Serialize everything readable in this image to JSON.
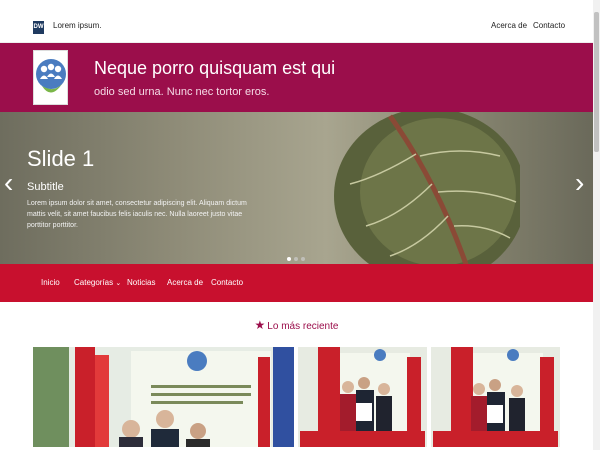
{
  "topbar": {
    "logo_text": "DW",
    "brand": "Lorem ipsum.",
    "links": [
      "Acerca de",
      "Contacto"
    ]
  },
  "header": {
    "title": "Neque porro quisquam est qui",
    "subtitle": "odio sed urna. Nunc nec tortor eros."
  },
  "hero": {
    "title": "Slide 1",
    "subtitle": "Subtitle",
    "text": "Lorem ipsum dolor sit amet, consectetur adipiscing elit. Aliquam dictum mattis velit, sit amet faucibus felis iaculis nec. Nulla laoreet justo vitae porttitor porttitor.",
    "dots": 3,
    "active_dot": 1
  },
  "nav": {
    "items": [
      "Inicio",
      "Categorías",
      "Noticias",
      "Acerca de",
      "Contacto"
    ]
  },
  "section": {
    "title": "Lo más reciente"
  },
  "colors": {
    "maroon": "#9b0e4b",
    "red": "#c8102e"
  }
}
